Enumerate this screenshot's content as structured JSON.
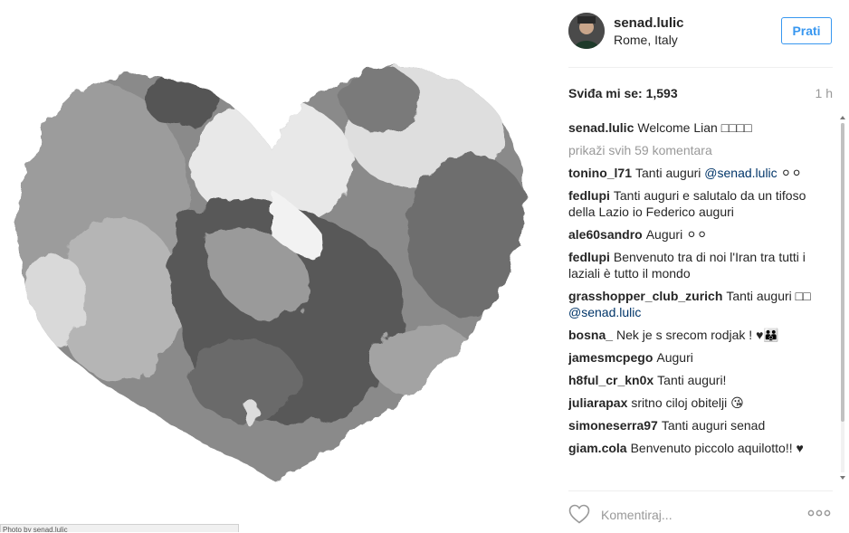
{
  "photo": {
    "credit": "Photo by senad.lulic"
  },
  "post": {
    "username": "senad.lulic",
    "location": "Rome, Italy",
    "follow_label": "Prati",
    "likes_label": "Sviđa mi se: 1,593",
    "time": "1 h"
  },
  "caption": {
    "user": "senad.lulic",
    "text": "Welcome Lian □□□□"
  },
  "view_all": "prikaži svih 59 komentara",
  "comments": [
    {
      "user": "tonino_l71",
      "text": "Tanti auguri ",
      "mention": "@senad.lulic",
      "after": " ⚪⚪"
    },
    {
      "user": "fedlupi",
      "text": "Tanti auguri e salutalo da un tifoso della Lazio io Federico auguri"
    },
    {
      "user": "ale60sandro",
      "text": "Auguri ⚪⚪"
    },
    {
      "user": "fedlupi",
      "text": "Benvenuto tra di noi l'Iran tra tutti i laziali è tutto il mondo"
    },
    {
      "user": "grasshopper_club_zurich",
      "text": "Tanti auguri □□ ",
      "mention": "@senad.lulic"
    },
    {
      "user": "bosna_",
      "text": "Nek je s srecom rodjak ! ♥👪"
    },
    {
      "user": "jamesmcpego",
      "text": "Auguri"
    },
    {
      "user": "h8ful_cr_kn0x",
      "text": "Tanti auguri!"
    },
    {
      "user": "juliarapax",
      "text": "sritno ciloj obitelji 😘"
    },
    {
      "user": "simoneserra97",
      "text": "Tanti auguri senad"
    },
    {
      "user": "giam.cola",
      "text": "Benvenuto piccolo aquilotto!! ♥"
    }
  ],
  "footer": {
    "comment_placeholder": "Komentiraj..."
  },
  "icons": {
    "like": "heart-outline-icon",
    "more": "more-options-icon"
  },
  "colors": {
    "accent": "#3897f0",
    "mention": "#003569",
    "muted": "#999999"
  }
}
